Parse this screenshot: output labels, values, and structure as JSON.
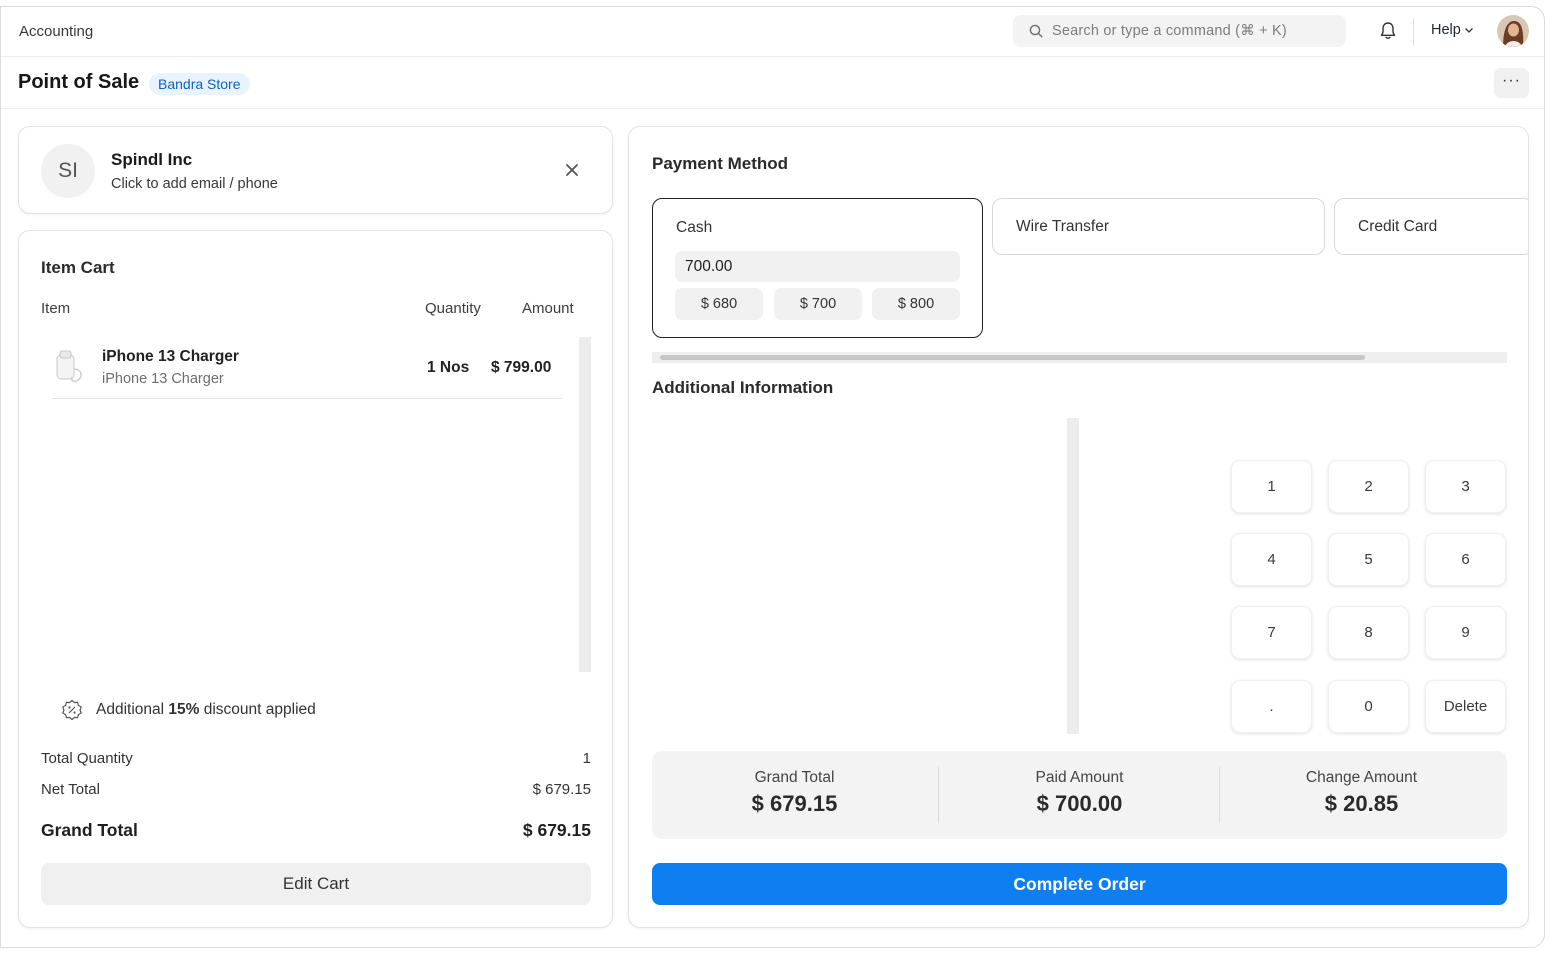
{
  "topbar": {
    "app_name": "Accounting",
    "search_placeholder": "Search or type a command (⌘ + K)",
    "help_label": "Help"
  },
  "header": {
    "title": "Point of Sale",
    "store": "Bandra Store",
    "more_label": "···"
  },
  "customer": {
    "initials": "SI",
    "name": "Spindl Inc",
    "subtitle": "Click to add email / phone"
  },
  "cart": {
    "title": "Item Cart",
    "columns": {
      "item": "Item",
      "quantity": "Quantity",
      "amount": "Amount"
    },
    "items": [
      {
        "name": "iPhone 13 Charger",
        "description": "iPhone 13 Charger",
        "quantity": "1 Nos",
        "amount": "$ 799.00"
      }
    ],
    "discount": {
      "prefix": "Additional ",
      "percent": "15%",
      "suffix": " discount applied"
    },
    "summary": {
      "total_quantity_label": "Total Quantity",
      "total_quantity": "1",
      "net_total_label": "Net Total",
      "net_total": "$ 679.15",
      "grand_total_label": "Grand Total",
      "grand_total": "$ 679.15"
    },
    "edit_label": "Edit Cart"
  },
  "payment": {
    "title": "Payment Method",
    "methods": [
      {
        "label": "Cash",
        "selected": true
      },
      {
        "label": "Wire Transfer",
        "selected": false
      },
      {
        "label": "Credit Card",
        "selected": false
      }
    ],
    "cash_amount": "700.00",
    "quick_amounts": [
      "$ 680",
      "$ 700",
      "$ 800"
    ],
    "additional_title": "Additional Information",
    "keypad": [
      "1",
      "2",
      "3",
      "4",
      "5",
      "6",
      "7",
      "8",
      "9",
      ".",
      "0",
      "Delete"
    ],
    "totals": {
      "grand_total_label": "Grand Total",
      "grand_total": "$ 679.15",
      "paid_label": "Paid Amount",
      "paid": "$ 700.00",
      "change_label": "Change Amount",
      "change": "$ 20.85"
    },
    "complete_label": "Complete Order"
  },
  "colors": {
    "primary": "#0f7ef0",
    "badge_bg": "#e8f3fd",
    "badge_text": "#0b63c6"
  }
}
